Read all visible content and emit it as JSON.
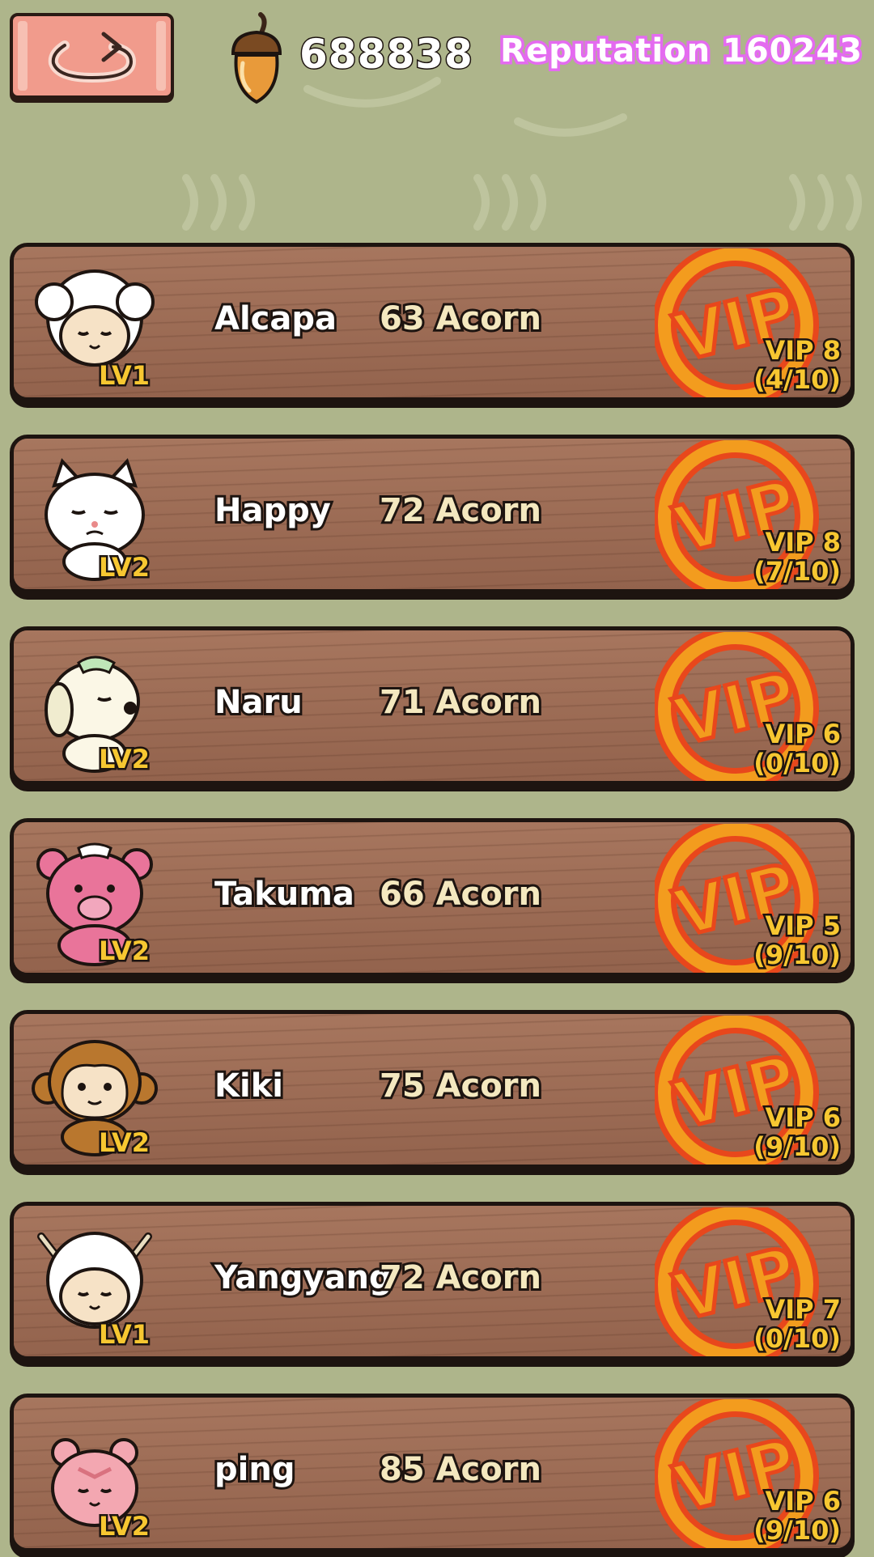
{
  "header": {
    "acorn_count": "688838",
    "reputation": "Reputation 160243"
  },
  "rows": [
    {
      "name": "Alcapa",
      "price": "63 Acorn",
      "level": "LV1",
      "vip_level": "VIP 8",
      "vip_progress": "(4/10)",
      "avatar": "sheep-avatar-icon"
    },
    {
      "name": "Happy",
      "price": "72 Acorn",
      "level": "LV2",
      "vip_level": "VIP 8",
      "vip_progress": "(7/10)",
      "avatar": "cat-avatar-icon"
    },
    {
      "name": "Naru",
      "price": "71 Acorn",
      "level": "LV2",
      "vip_level": "VIP 6",
      "vip_progress": "(0/10)",
      "avatar": "dog-avatar-icon"
    },
    {
      "name": "Takuma",
      "price": "66 Acorn",
      "level": "LV2",
      "vip_level": "VIP 5",
      "vip_progress": "(9/10)",
      "avatar": "bear-avatar-icon"
    },
    {
      "name": "Kiki",
      "price": "75 Acorn",
      "level": "LV2",
      "vip_level": "VIP 6",
      "vip_progress": "(9/10)",
      "avatar": "monkey-avatar-icon"
    },
    {
      "name": "Yangyang",
      "price": "72 Acorn",
      "level": "LV1",
      "vip_level": "VIP 7",
      "vip_progress": "(0/10)",
      "avatar": "goat-avatar-icon"
    },
    {
      "name": "ping",
      "price": "85 Acorn",
      "level": "LV2",
      "vip_level": "VIP 6",
      "vip_progress": "(9/10)",
      "avatar": "hamster-avatar-icon"
    }
  ],
  "colors": {
    "background": "#aeb58b",
    "wood": "#9a6a54",
    "vip_stamp": "#f39c1e",
    "vip_stamp_outline": "#e8471c",
    "reputation_outline": "#e46bf0",
    "level_text": "#f7c731"
  }
}
